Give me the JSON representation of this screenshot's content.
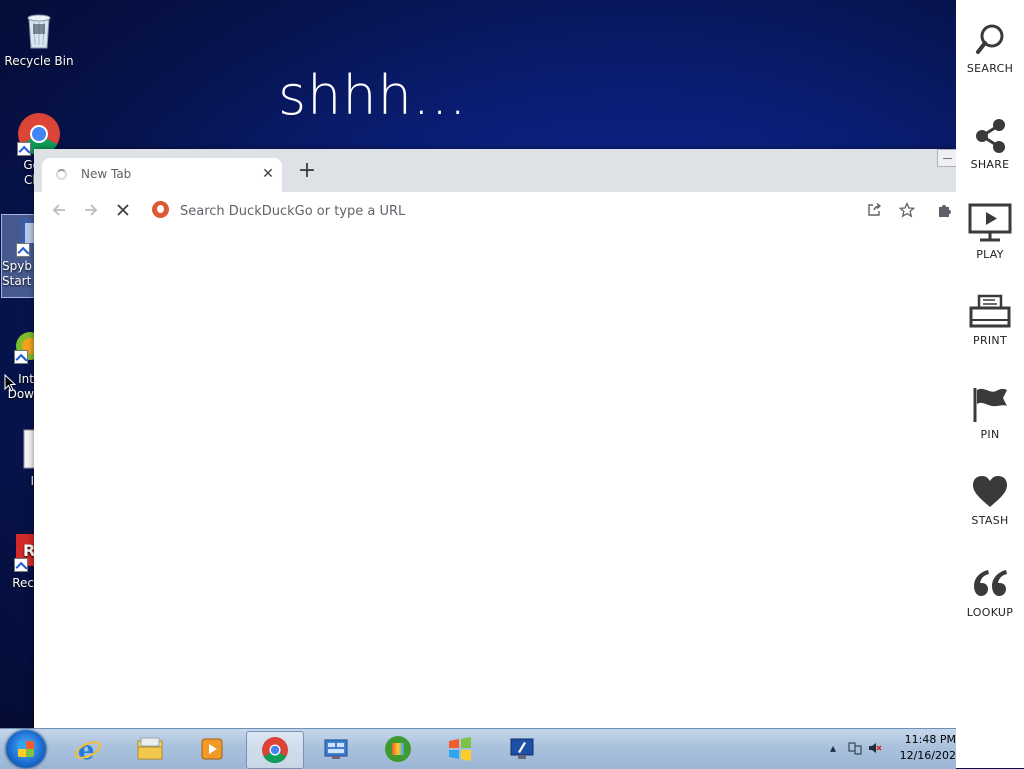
{
  "desktop": {
    "overlay_text": "shhh...",
    "icons": [
      {
        "label": "Recycle Bin"
      },
      {
        "label": "Go\nCh"
      },
      {
        "label": "Spyb\nStart"
      },
      {
        "label": "Int\nDow"
      },
      {
        "label": "I"
      },
      {
        "label": "Rec"
      }
    ]
  },
  "browser": {
    "tab_title": "New Tab",
    "omnibox_placeholder": "Search DuckDuckGo or type a URL"
  },
  "side_panel": {
    "items": [
      {
        "label": "SEARCH",
        "icon": "search-icon"
      },
      {
        "label": "SHARE",
        "icon": "share-icon"
      },
      {
        "label": "PLAY",
        "icon": "play-icon"
      },
      {
        "label": "PRINT",
        "icon": "print-icon"
      },
      {
        "label": "PIN",
        "icon": "flag-icon"
      },
      {
        "label": "STASH",
        "icon": "heart-icon"
      },
      {
        "label": "LOOKUP",
        "icon": "quote-icon"
      }
    ]
  },
  "taskbar": {
    "clock_time": "11:48 PM",
    "clock_date": "12/16/202"
  }
}
